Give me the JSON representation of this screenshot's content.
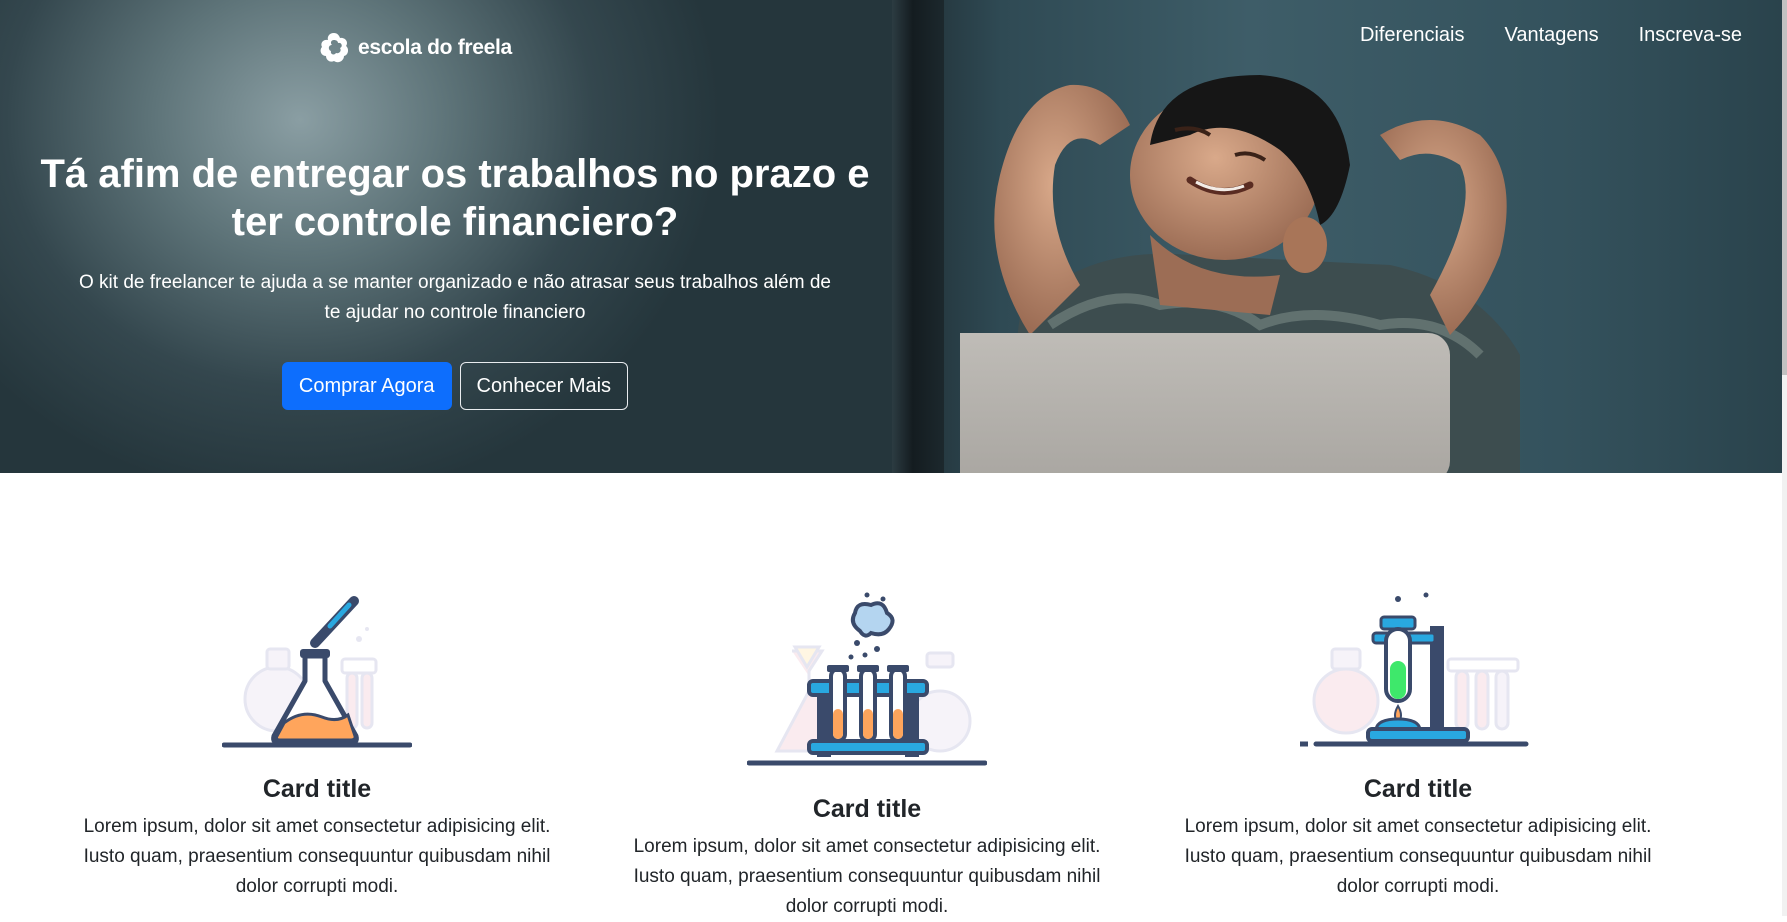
{
  "header": {
    "logo_text": "escola do freela",
    "nav": [
      {
        "label": "Diferenciais"
      },
      {
        "label": "Vantagens"
      },
      {
        "label": "Inscreva-se"
      }
    ]
  },
  "hero": {
    "title_line1": "Tá afim de entregar os trabalhos no prazo e",
    "title_line2": "ter controle financiero?",
    "subtitle_line1": "O kit de freelancer te ajuda a se manter organizado e não atrasar seus trabalhos além de",
    "subtitle_line2": "te ajudar no controle financiero",
    "primary_button": "Comprar Agora",
    "secondary_button": "Conhecer Mais"
  },
  "cards": [
    {
      "icon": "flask-dropper-icon",
      "title": "Card title",
      "text_line1": "Lorem ipsum, dolor sit amet consectetur adipisicing elit.",
      "text_line2": "Iusto quam, praesentium consequuntur quibusdam nihil",
      "text_line3": "dolor corrupti modi."
    },
    {
      "icon": "test-tubes-rack-icon",
      "title": "Card title",
      "text_line1": "Lorem ipsum, dolor sit amet consectetur adipisicing elit.",
      "text_line2": "Iusto quam, praesentium consequuntur quibusdam nihil",
      "text_line3": "dolor corrupti modi."
    },
    {
      "icon": "burner-stand-icon",
      "title": "Card title",
      "text_line1": "Lorem ipsum, dolor sit amet consectetur adipisicing elit.",
      "text_line2": "Iusto quam, praesentium consequuntur quibusdam nihil",
      "text_line3": "dolor corrupti modi."
    }
  ],
  "colors": {
    "primary": "#0d6efd",
    "hero_bg": "#34474e",
    "text_dark": "#212529",
    "icon_navy": "#3a4a6b",
    "icon_blue": "#29a8e0",
    "icon_orange": "#ffa55c",
    "icon_green": "#3ee86b"
  }
}
